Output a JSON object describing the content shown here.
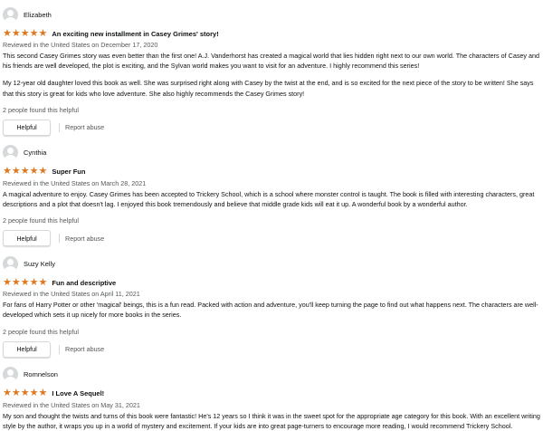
{
  "colors": {
    "star": "#de7921",
    "avatar": "#d5d9d9",
    "muted_text": "#565959"
  },
  "icons": {
    "avatar": "default-profile-icon",
    "star": "filled-star-icon"
  },
  "reviews": [
    {
      "reviewer": "Elizabeth",
      "rating": 5,
      "title": "An exciting new installment in Casey Grimes' story!",
      "date": "Reviewed in the United States on December 17, 2020",
      "paragraphs": [
        "This second Casey Grimes story was even better than the first one! A.J. Vanderhorst has created a magical world that lies hidden right next to our own world. The characters of Casey and his friends are well developed, the plot is exciting, and the Sylvan world makes you want to visit for an adventure. I highly recommend this series!",
        "My 12-year old daughter loved this book as well. She was surprised right along with Casey by the twist at the end, and is so excited for the next piece of the story to be written! She says that this story is great for kids who love adventure. She also highly recommends the Casey Grimes story!"
      ],
      "helpful_count": "2 people found this helpful",
      "helpful_label": "Helpful",
      "report_label": "Report abuse"
    },
    {
      "reviewer": "Cynthia",
      "rating": 5,
      "title": "Super Fun",
      "date": "Reviewed in the United States on March 28, 2021",
      "paragraphs": [
        "A magical adventure to enjoy. Casey Grimes has been accepted to Trickery School, which is a school where monster control is taught. The book is filled with interesting characters, great descriptions and a plot that doesn't lag. I enjoyed this book tremendously and believe that middle grade kids will eat it up. A wonderful book by a wonderful author."
      ],
      "helpful_count": "2 people found this helpful",
      "helpful_label": "Helpful",
      "report_label": "Report abuse"
    },
    {
      "reviewer": "Suzy Kelly",
      "rating": 5,
      "title": "Fun and descriptive",
      "date": "Reviewed in the United States on April 11, 2021",
      "paragraphs": [
        "For fans of Harry Potter or other 'magical' beings, this is a fun read. Packed with action and adventure, you'll keep turning the page to find out what happens next. The characters are well-developed which sets it up nicely for more books in the series."
      ],
      "helpful_count": "2 people found this helpful",
      "helpful_label": "Helpful",
      "report_label": "Report abuse"
    },
    {
      "reviewer": "Romnelson",
      "rating": 5,
      "title": "I Love A Sequel!",
      "date": "Reviewed in the United States on May 31, 2021",
      "paragraphs": [
        "My son and thought the twists and turns of this book were fantastic! He's 12 years so I think it was in the sweet spot for the appropriate age category for this book. With an excellent writing style by the author, it wraps you up in a world of mystery and excitement. If your kids are into great page-turners to encourage more reading, I would recommend Trickery School."
      ]
    }
  ]
}
